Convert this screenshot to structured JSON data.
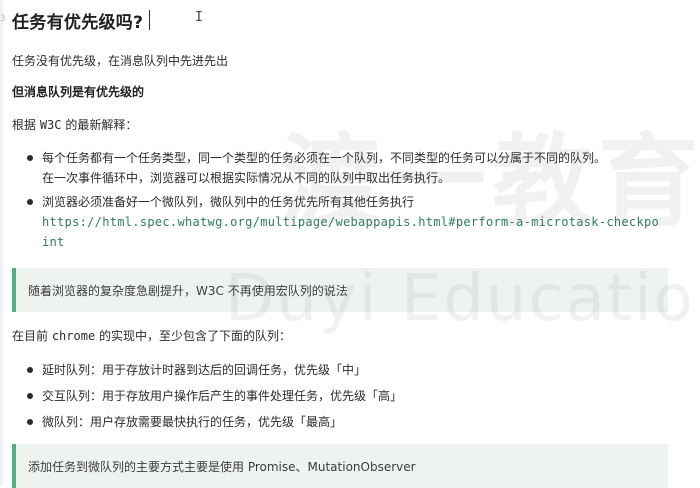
{
  "heading": {
    "line_number": "3",
    "title": "任务有优先级吗?"
  },
  "paragraphs": {
    "p1": "任务没有优先级，在消息队列中先进先出",
    "p2": "但消息队列是有优先级的",
    "p3_prefix": "根据 ",
    "p3_code": "W3C",
    "p3_suffix": " 的最新解释："
  },
  "list1": {
    "item1_line1": "每个任务都有一个任务类型，同一个类型的任务必须在一个队列，不同类型的任务可以分属于不同的队列。",
    "item1_line2": "在一次事件循环中，浏览器可以根据实际情况从不同的队列中取出任务执行。",
    "item2_line1": "浏览器必须准备好一个微队列，微队列中的任务优先所有其他任务执行",
    "item2_link_line1": "https://html.spec.whatwg.org/multipage/webappapis.html#perform-a-microtask-checkpo",
    "item2_link_line2": "int"
  },
  "quote1": "随着浏览器的复杂度急剧提升，W3C 不再使用宏队列的说法",
  "p4": {
    "prefix": "在目前 ",
    "code": "chrome",
    "suffix": " 的实现中，至少包含了下面的队列："
  },
  "list2": {
    "item1": "延时队列：用于存放计时器到达后的回调任务，优先级「中」",
    "item2": "交互队列：用于存放用户操作后产生的事件处理任务，优先级「高」",
    "item3": "微队列：用户存放需要最快执行的任务，优先级「最高」"
  },
  "quote2": "添加任务到微队列的主要方式主要是使用 Promise、MutationObserver",
  "watermark": {
    "cn": "渡一教育",
    "en": "Duyi Education"
  },
  "colors": {
    "accent": "#55b07b",
    "quote_bg": "#eef3f0",
    "link": "#2e7d5b"
  }
}
